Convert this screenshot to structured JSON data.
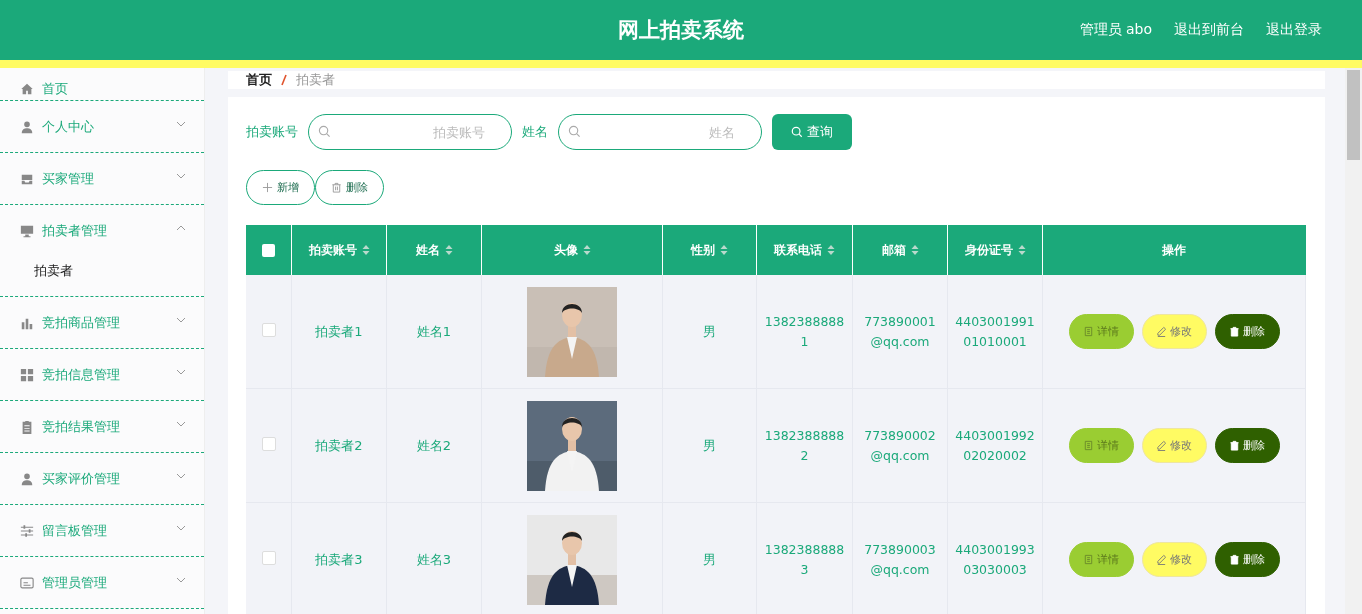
{
  "header": {
    "title": "网上拍卖系统",
    "user": "管理员 abo",
    "links": [
      "退出到前台",
      "退出登录"
    ]
  },
  "sidebar": {
    "items": [
      {
        "label": "首页"
      },
      {
        "label": "个人中心",
        "expanded": false
      },
      {
        "label": "买家管理",
        "expanded": false
      },
      {
        "label": "拍卖者管理",
        "expanded": true,
        "children": [
          {
            "label": "拍卖者"
          }
        ]
      },
      {
        "label": "竞拍商品管理",
        "expanded": false
      },
      {
        "label": "竞拍信息管理",
        "expanded": false
      },
      {
        "label": "竞拍结果管理",
        "expanded": false
      },
      {
        "label": "买家评价管理",
        "expanded": false
      },
      {
        "label": "留言板管理",
        "expanded": false
      },
      {
        "label": "管理员管理",
        "expanded": false
      }
    ]
  },
  "breadcrumb": [
    "首页",
    "拍卖者"
  ],
  "search": {
    "fields": [
      {
        "label": "拍卖账号",
        "placeholder": "拍卖账号"
      },
      {
        "label": "姓名",
        "placeholder": "姓名"
      }
    ],
    "button": "查询"
  },
  "actions": [
    "新增",
    "删除"
  ],
  "table": {
    "select_all": {
      "checked": false
    },
    "columns": [
      "拍卖账号",
      "姓名",
      "头像",
      "性别",
      "联系电话",
      "邮箱",
      "身份证号",
      "操作"
    ],
    "rows": [
      {
        "checked": false,
        "account": "拍卖者1",
        "name": "姓名1",
        "gender": "男",
        "phone": "13823888881",
        "email": "773890001@qq.com",
        "id_number": "440300199101010001",
        "buttons": [
          "详情",
          "修改",
          "删除"
        ]
      },
      {
        "checked": false,
        "account": "拍卖者2",
        "name": "姓名2",
        "gender": "男",
        "phone": "13823888882",
        "email": "773890002@qq.com",
        "id_number": "440300199202020002",
        "buttons": [
          "详情",
          "修改",
          "删除"
        ]
      },
      {
        "checked": false,
        "account": "拍卖者3",
        "name": "姓名3",
        "gender": "男",
        "phone": "13823888883",
        "email": "773890003@qq.com",
        "id_number": "440300199303030003",
        "buttons": [
          "详情",
          "修改",
          "删除"
        ]
      }
    ]
  }
}
